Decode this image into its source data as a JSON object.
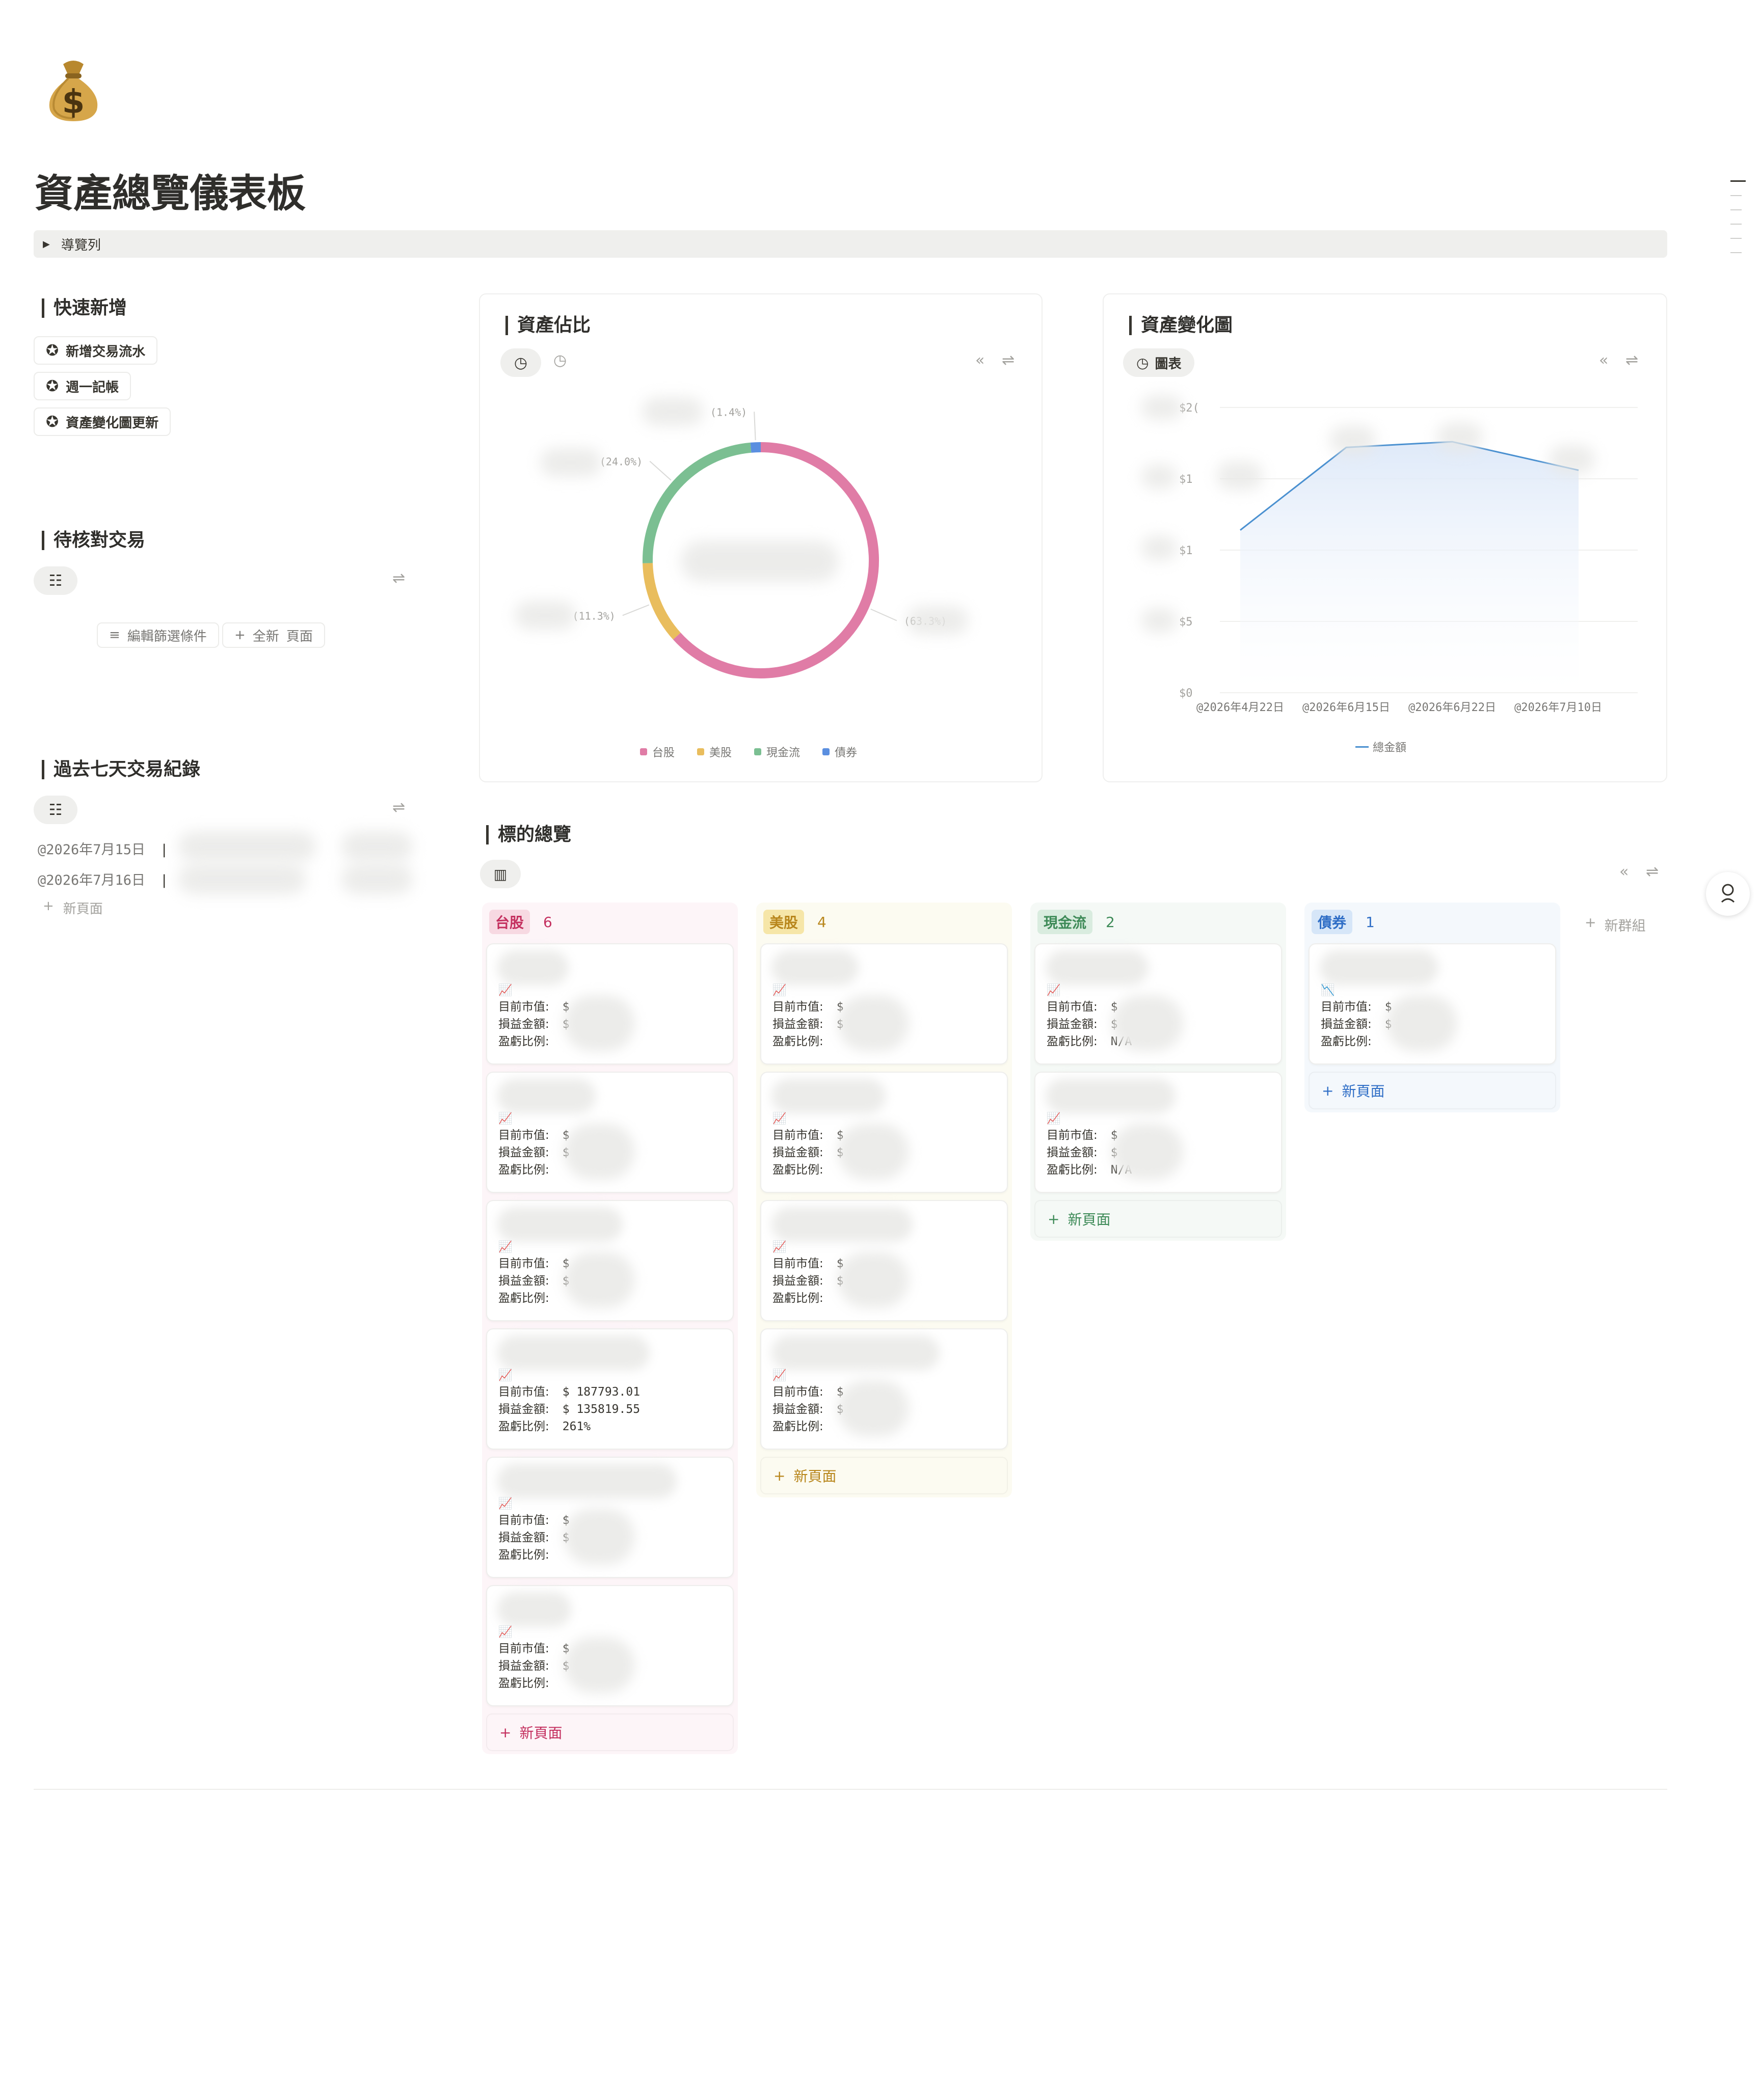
{
  "page": {
    "icon": "money-bag",
    "title": "資產總覽儀表板",
    "nav_toggle": "導覽列"
  },
  "quick_add": {
    "heading": "快速新增",
    "buttons": [
      "新增交易流水",
      "週一記帳",
      "資產變化圖更新"
    ]
  },
  "pending": {
    "heading": "待核對交易",
    "filter_label": "編輯篩選條件",
    "new_label": "全新",
    "page_label": "頁面"
  },
  "recent": {
    "heading": "過去七天交易紀錄",
    "rows": [
      "@2026年7月15日",
      "@2026年7月16日"
    ],
    "new_page": "新頁面"
  },
  "allocation": {
    "heading": "資產佔比",
    "chart_data": {
      "type": "pie",
      "categories": [
        "台股",
        "美股",
        "現金流",
        "債券"
      ],
      "values": [
        63.3,
        11.3,
        24.0,
        1.4
      ],
      "labels": [
        "(63.3%)",
        "(11.3%)",
        "(24.0%)",
        "(1.4%)"
      ],
      "colors": [
        "#e07ca6",
        "#e9bd5d",
        "#7bbf92",
        "#5b8fe0"
      ],
      "legend": "bottom"
    }
  },
  "trend": {
    "heading": "資產變化圖",
    "view_label": "圖表",
    "chart_data": {
      "type": "area",
      "x": [
        "@2026年4月22日",
        "@2026年6月15日",
        "@2026年6月22日",
        "@2026年7月10日"
      ],
      "y_ticks": [
        "$0",
        "$5",
        "$1",
        "$1",
        "$2("
      ],
      "series": [
        {
          "name": "總金額",
          "values": [
            0.57,
            0.86,
            0.88,
            0.78
          ]
        }
      ],
      "ylim": [
        0,
        1
      ],
      "grid": true,
      "legend": "bottom"
    }
  },
  "board": {
    "heading": "標的總覽",
    "new_group": "新群組",
    "new_page": "新頁面",
    "field_labels": [
      "目前市值:",
      "損益金額:",
      "盈虧比例:"
    ],
    "columns": [
      {
        "name": "台股",
        "count": "6",
        "color": "#c4305f",
        "tag_bg": "#f7d9e2",
        "bg": "#fdf5f8",
        "icon": "📈",
        "cards": [
          [
            "$",
            "$",
            ""
          ],
          [
            "$",
            "$ .",
            ""
          ],
          [
            "$",
            "$",
            ""
          ],
          [
            "$ 187793.01",
            "$ 135819.55",
            "261%"
          ],
          [
            "$",
            "$ .",
            ""
          ],
          [
            "$",
            "$",
            ""
          ]
        ]
      },
      {
        "name": "美股",
        "count": "4",
        "color": "#b8861b",
        "tag_bg": "#f6e6a8",
        "bg": "#fcfbf1",
        "icon": "📈",
        "cards": [
          [
            "$",
            "$",
            ""
          ],
          [
            "$",
            "$",
            ""
          ],
          [
            "$",
            "$",
            ""
          ],
          [
            "$",
            "$",
            ""
          ]
        ]
      },
      {
        "name": "現金流",
        "count": "2",
        "color": "#3d8a57",
        "tag_bg": "#d9ecdf",
        "bg": "#f5f9f6",
        "icon": "📈",
        "cards": [
          [
            "$",
            "$",
            "N/A"
          ],
          [
            "$",
            "$",
            "N/A"
          ]
        ]
      },
      {
        "name": "債券",
        "count": "1",
        "color": "#2f6ec6",
        "tag_bg": "#d6e6f8",
        "bg": "#f4f8fc",
        "icon": "📉",
        "cards": [
          [
            "$",
            "$",
            ""
          ]
        ]
      }
    ]
  }
}
